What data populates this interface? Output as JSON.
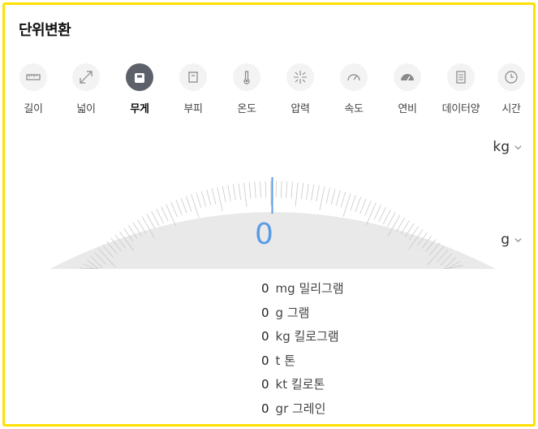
{
  "title": "단위변환",
  "tabs": [
    {
      "label": "길이",
      "icon": "ruler-icon",
      "active": false
    },
    {
      "label": "넓이",
      "icon": "expand-icon",
      "active": false
    },
    {
      "label": "무게",
      "icon": "weight-icon",
      "active": true
    },
    {
      "label": "부피",
      "icon": "beaker-icon",
      "active": false
    },
    {
      "label": "온도",
      "icon": "thermometer-icon",
      "active": false
    },
    {
      "label": "압력",
      "icon": "pressure-icon",
      "active": false
    },
    {
      "label": "속도",
      "icon": "speedometer-icon",
      "active": false
    },
    {
      "label": "연비",
      "icon": "fuel-gauge-icon",
      "active": false
    },
    {
      "label": "데이터양",
      "icon": "document-icon",
      "active": false
    },
    {
      "label": "시간",
      "icon": "clock-icon",
      "active": false
    }
  ],
  "from_unit": "kg",
  "to_unit": "g",
  "reading": "0",
  "accent_color": "#5a9be6",
  "results": [
    {
      "value": "0",
      "unit": "mg 밀리그램"
    },
    {
      "value": "0",
      "unit": "g 그램"
    },
    {
      "value": "0",
      "unit": "kg 킬로그램"
    },
    {
      "value": "0",
      "unit": "t 톤"
    },
    {
      "value": "0",
      "unit": "kt 킬로톤"
    },
    {
      "value": "0",
      "unit": "gr 그레인"
    }
  ]
}
